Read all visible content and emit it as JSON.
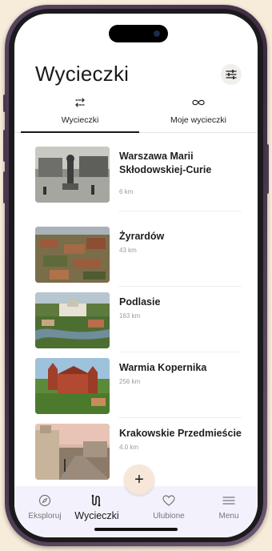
{
  "header": {
    "title": "Wycieczki"
  },
  "tabs": [
    {
      "label": "Wycieczki",
      "icon": "shuffle-arrows-icon",
      "active": true
    },
    {
      "label": "Moje wycieczki",
      "icon": "infinity-icon",
      "active": false
    }
  ],
  "trips": [
    {
      "name": "Warszawa Marii Skłodowskiej-Curie",
      "distance": "6 km",
      "image": "black-and-white-city-square-photo"
    },
    {
      "name": "Żyrardów",
      "distance": "43 km",
      "image": "aerial-town-photo"
    },
    {
      "name": "Podlasie",
      "distance": "163 km",
      "image": "aerial-palace-photo"
    },
    {
      "name": "Warmia Kopernika",
      "distance": "256 km",
      "image": "gothic-cathedral-photo"
    },
    {
      "name": "Krakowskie Przedmieście",
      "distance": "4.0 km",
      "image": "city-street-dusk-photo"
    }
  ],
  "fab": {
    "label": "+"
  },
  "bottom_nav": [
    {
      "label": "Eksploruj",
      "icon": "compass-icon",
      "active": false
    },
    {
      "label": "Wycieczki",
      "icon": "route-icon",
      "active": true
    },
    {
      "label": "Ulubione",
      "icon": "heart-icon",
      "active": false
    },
    {
      "label": "Menu",
      "icon": "hamburger-icon",
      "active": false
    }
  ],
  "colors": {
    "background": "#f7ecd9",
    "phone_frame": "#4a3850",
    "accent_text": "#1a1a1a",
    "nav_background": "#f3f1fb",
    "fab_background": "#f6e7d9"
  }
}
